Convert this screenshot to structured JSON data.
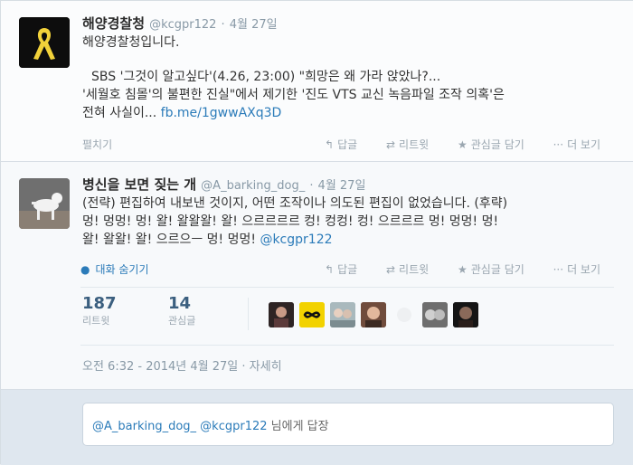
{
  "tweet1": {
    "name": "해양경찰청",
    "handle": "@kcgpr122",
    "date": "4월 27일",
    "line1": "해양경찰청입니다.",
    "line2": "SBS '그것이 알고싶다'(4.26, 23:00) \"희망은 왜 가라 앉았나?...",
    "line3": "'세월호 침몰'의 불편한 진실\"에서 제기한 '진도 VTS 교신 녹음파일 조작 의혹'은",
    "line4_prefix": "전혀 사실이...",
    "line4_link": "fb.me/1gwwAXq3D",
    "expand": "펼치기",
    "actions": {
      "reply": "답글",
      "retweet": "리트윗",
      "favorite": "관심글 담기",
      "more": "더 보기"
    }
  },
  "tweet2": {
    "name": "병신을 보면 짖는 개",
    "handle": "@A_barking_dog_",
    "date": "4월 27일",
    "line1": "(전략) 편집하여 내보낸 것이지, 어떤 조작이나 의도된 편집이 없었습니다. (후략)",
    "line2": "멍! 멍멍! 멍! 왈! 왈왈왈! 왈! 으르르르르 컹! 컹컹! 컹! 으르르르 멍! 멍멍! 멍!",
    "line3_prefix": "왈! 왈왈! 왈! 으르으ㅡ 멍! 멍멍!",
    "line3_mention": "@kcgpr122",
    "hide_convo": "대화 숨기기",
    "actions": {
      "reply": "답글",
      "retweet": "리트윗",
      "favorite": "관심글 담기",
      "more": "더 보기"
    },
    "retweets_count": "187",
    "retweets_label": "리트윗",
    "favorites_count": "14",
    "favorites_label": "관심글",
    "timestamp": "오전 6:32 - 2014년 4월 27일",
    "details": "자세히"
  },
  "reply": {
    "mentions": "@A_barking_dog_ @kcgpr122",
    "suffix": "님에게 답장"
  },
  "colors": {
    "link": "#2b7bb9",
    "accent": "#2b7bb9"
  }
}
